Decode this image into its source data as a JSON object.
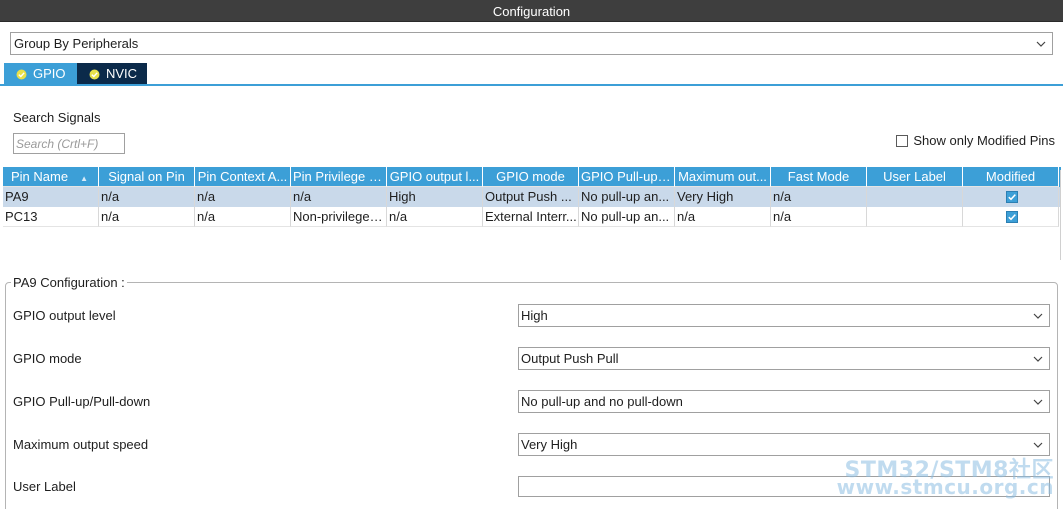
{
  "window": {
    "title": "Configuration"
  },
  "group_by": {
    "value": "Group By Peripherals"
  },
  "tabs": [
    {
      "label": "GPIO",
      "icon": "check-circle-icon"
    },
    {
      "label": "NVIC",
      "icon": "check-circle-icon"
    }
  ],
  "search": {
    "label": "Search Signals",
    "placeholder": "Search (Crtl+F)"
  },
  "filter": {
    "only_modified_label": "Show only Modified Pins",
    "checked": false
  },
  "table": {
    "columns": [
      "Pin Name",
      "Signal on Pin",
      "Pin Context A...",
      "Pin Privilege a...",
      "GPIO output l...",
      "GPIO mode",
      "GPIO Pull-up/...",
      "Maximum out...",
      "Fast Mode",
      "User Label",
      "Modified"
    ],
    "rows": [
      {
        "cells": [
          "PA9",
          "n/a",
          "n/a",
          "n/a",
          "High",
          "Output Push ...",
          "No pull-up an...",
          "Very High",
          "n/a",
          ""
        ],
        "modified": true,
        "selected": true
      },
      {
        "cells": [
          "PC13",
          "n/a",
          "n/a",
          "Non-privileged...",
          "n/a",
          "External Interr...",
          "No pull-up an...",
          "n/a",
          "n/a",
          ""
        ],
        "modified": true,
        "selected": false
      }
    ]
  },
  "config": {
    "title": "PA9 Configuration :",
    "fields": [
      {
        "label": "GPIO output level",
        "value": "High",
        "type": "select"
      },
      {
        "label": "GPIO mode",
        "value": "Output Push Pull",
        "type": "select"
      },
      {
        "label": "GPIO Pull-up/Pull-down",
        "value": "No pull-up and no pull-down",
        "type": "select"
      },
      {
        "label": "Maximum output speed",
        "value": "Very High",
        "type": "select"
      },
      {
        "label": "User Label",
        "value": "",
        "type": "text"
      }
    ]
  },
  "watermark": {
    "line1": "STM32/STM8社区",
    "line2": "www.stmcu.org.cn"
  },
  "colors": {
    "accent": "#3c9fd7",
    "tab_dark": "#0b2a4a",
    "title_bar": "#3e3e3e",
    "selection": "#c9d9ea"
  }
}
